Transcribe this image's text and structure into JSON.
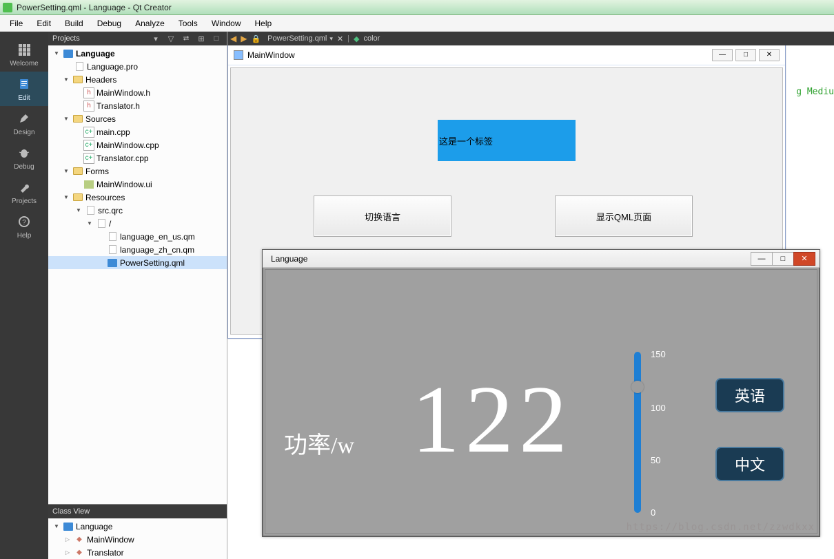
{
  "window": {
    "title": "PowerSetting.qml - Language - Qt Creator"
  },
  "menu": [
    "File",
    "Edit",
    "Build",
    "Debug",
    "Analyze",
    "Tools",
    "Window",
    "Help"
  ],
  "leftRail": [
    {
      "label": "Welcome"
    },
    {
      "label": "Edit"
    },
    {
      "label": "Design"
    },
    {
      "label": "Debug"
    },
    {
      "label": "Projects"
    },
    {
      "label": "Help"
    }
  ],
  "toolbar": {
    "fileLabel": "PowerSetting.qml",
    "colorLabel": "color"
  },
  "codePeek": "g Mediu",
  "projects": {
    "title": "Projects",
    "root": "Language",
    "pro": "Language.pro",
    "headers": {
      "label": "Headers",
      "items": [
        "MainWindow.h",
        "Translator.h"
      ]
    },
    "sources": {
      "label": "Sources",
      "items": [
        "main.cpp",
        "MainWindow.cpp",
        "Translator.cpp"
      ]
    },
    "forms": {
      "label": "Forms",
      "items": [
        "MainWindow.ui"
      ]
    },
    "resources": {
      "label": "Resources",
      "qrc": "src.qrc",
      "slash": "/",
      "items": [
        "language_en_us.qm",
        "language_zh_cn.qm",
        "PowerSetting.qml"
      ]
    }
  },
  "classView": {
    "title": "Class View",
    "root": "Language",
    "items": [
      "MainWindow",
      "Translator"
    ]
  },
  "mainWindow": {
    "title": "MainWindow",
    "labelText": "这是一个标签",
    "btn1": "切换语言",
    "btn2": "显示QML页面"
  },
  "languageWindow": {
    "title": "Language",
    "powerLabel": "功率/w",
    "powerValue": "122",
    "ticks": {
      "t150": "150",
      "t100": "100",
      "t50": "50",
      "t0": "0"
    },
    "btnEn": "英语",
    "btnCn": "中文",
    "watermark": "https://blog.csdn.net/zzwdkxx"
  }
}
